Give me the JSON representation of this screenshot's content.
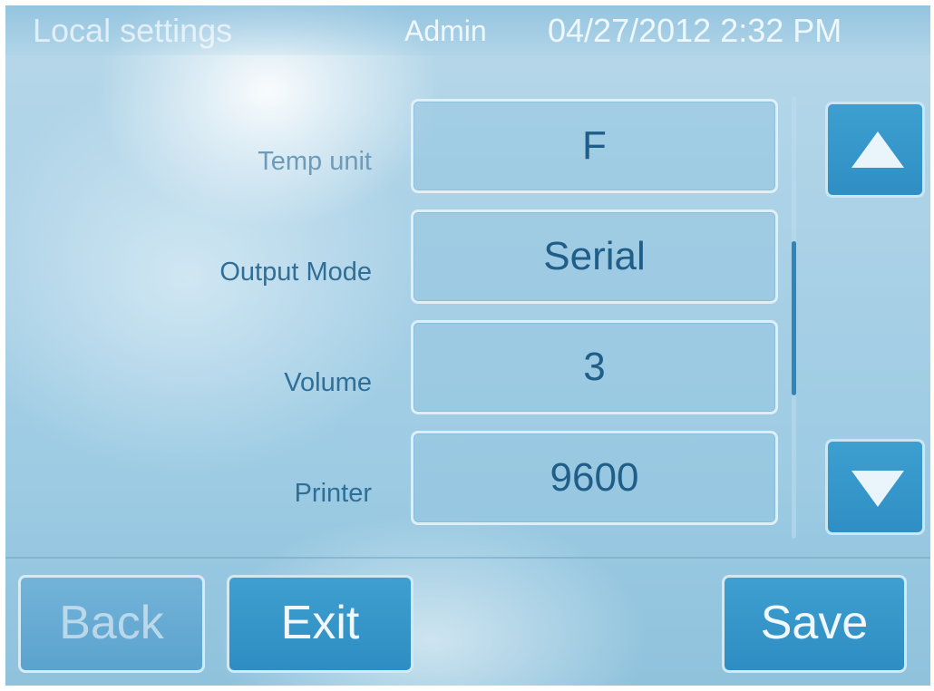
{
  "header": {
    "title": "Local settings",
    "user": "Admin",
    "datetime": "04/27/2012 2:32 PM"
  },
  "settings": [
    {
      "label": "Temp unit",
      "value": "F"
    },
    {
      "label": "Output Mode",
      "value": "Serial"
    },
    {
      "label": "Volume",
      "value": "3"
    },
    {
      "label": "Printer",
      "value": "9600"
    }
  ],
  "icons": {
    "scroll_up": "triangle-up-icon",
    "scroll_down": "triangle-down-icon"
  },
  "buttons": {
    "back": "Back",
    "exit": "Exit",
    "save": "Save"
  },
  "colors": {
    "accent": "#2f8fc4",
    "screen_bg": "#a8d0e6",
    "label_text": "#2f6f97"
  }
}
